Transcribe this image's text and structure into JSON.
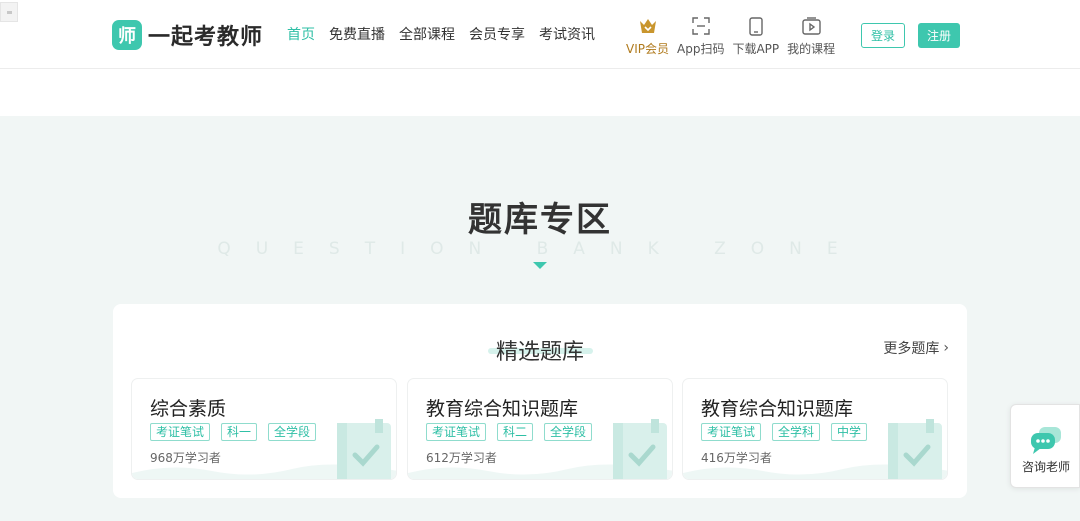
{
  "header": {
    "logo": {
      "badge": "师",
      "text": "一起考教师"
    },
    "nav": [
      {
        "label": "首页",
        "active": true
      },
      {
        "label": "免费直播",
        "active": false
      },
      {
        "label": "全部课程",
        "active": false
      },
      {
        "label": "会员专享",
        "active": false
      },
      {
        "label": "考试资讯",
        "active": false
      }
    ],
    "tools": {
      "vip": "VIP会员",
      "scan": "App扫码",
      "download": "下载APP",
      "my_courses": "我的课程"
    },
    "login": "登录",
    "register": "注册"
  },
  "section": {
    "title": "题库专区",
    "subtitle": "QUESTION BANK ZONE"
  },
  "panel": {
    "title": "精选题库",
    "more": "更多题库",
    "cards": [
      {
        "title": "综合素质",
        "tags": [
          "考证笔试",
          "科一",
          "全学段"
        ],
        "count": "968万学习者"
      },
      {
        "title": "教育综合知识题库",
        "tags": [
          "考证笔试",
          "科二",
          "全学段"
        ],
        "count": "612万学习者"
      },
      {
        "title": "教育综合知识题库",
        "tags": [
          "考证笔试",
          "全学科",
          "中学"
        ],
        "count": "416万学习者"
      }
    ]
  },
  "float": {
    "consult": "咨询老师"
  },
  "colors": {
    "accent": "#3ec7ae",
    "vip": "#b07a1c",
    "background": "#f1f6f5"
  }
}
